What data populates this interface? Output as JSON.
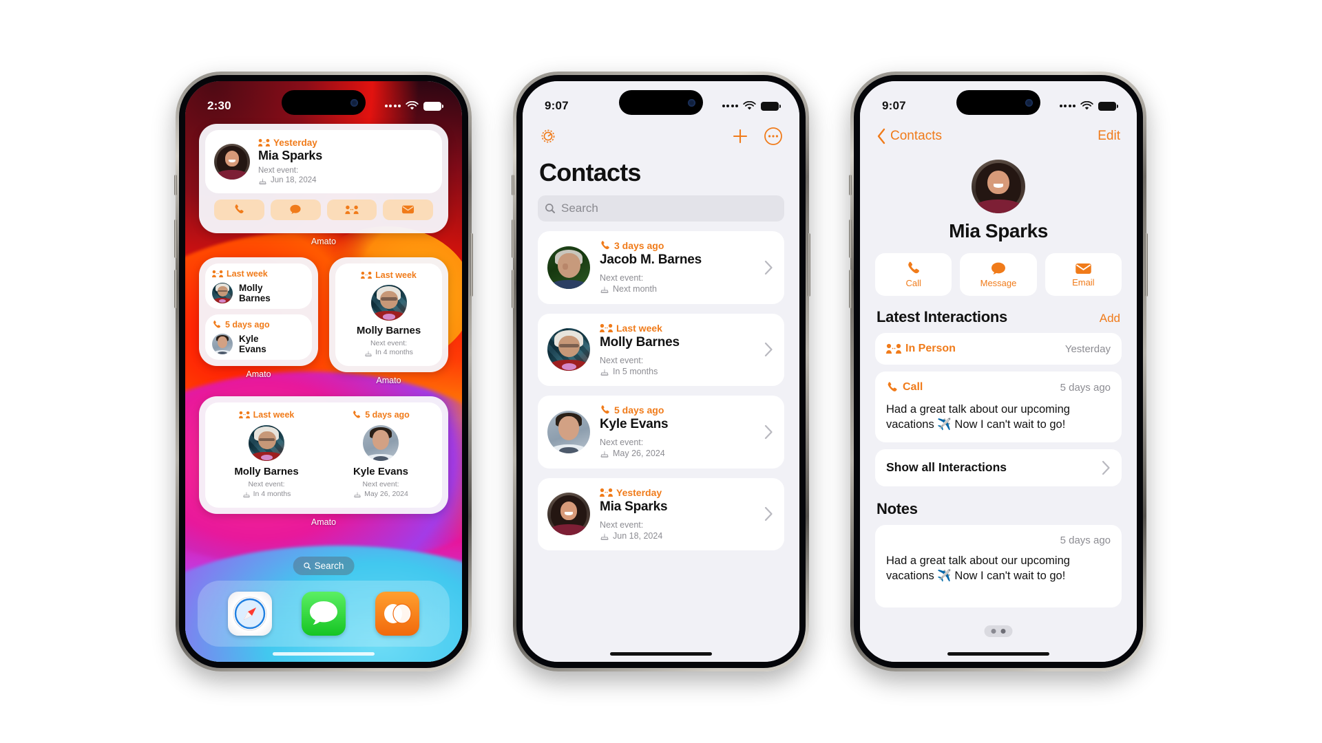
{
  "phone1": {
    "status": {
      "time": "2:30",
      "wifi": "wifi-icon",
      "battery": "battery-icon"
    },
    "widget_a": {
      "highlight": "Yesterday",
      "highlight_icon": "in-person-icon",
      "name": "Mia Sparks",
      "next_event_label": "Next event:",
      "next_event_value": "Jun 18, 2024",
      "event_icon": "birthday-cake-icon",
      "actions": [
        "phone-icon",
        "message-icon",
        "in-person-icon",
        "mail-icon"
      ],
      "label": "Amato"
    },
    "widget_b_left": {
      "items": [
        {
          "highlight": "Last week",
          "highlight_icon": "in-person-icon",
          "name": "Molly\nBarnes"
        },
        {
          "highlight": "5 days ago",
          "highlight_icon": "phone-icon",
          "name": "Kyle\nEvans"
        }
      ],
      "label": "Amato"
    },
    "widget_b_right": {
      "highlight": "Last week",
      "highlight_icon": "in-person-icon",
      "name": "Molly Barnes",
      "next_event_label": "Next event:",
      "next_event_value": "In 4 months",
      "event_icon": "birthday-cake-icon",
      "label": "Amato"
    },
    "widget_c": {
      "columns": [
        {
          "highlight": "Last week",
          "highlight_icon": "in-person-icon",
          "name": "Molly Barnes",
          "next_event_label": "Next event:",
          "next_event_value": "In 4 months",
          "event_icon": "birthday-cake-icon"
        },
        {
          "highlight": "5 days ago",
          "highlight_icon": "phone-icon",
          "name": "Kyle Evans",
          "next_event_label": "Next event:",
          "next_event_value": "May 26, 2024",
          "event_icon": "birthday-cake-icon"
        }
      ],
      "label": "Amato"
    },
    "search_pill": {
      "label": "Search",
      "icon": "search-icon"
    },
    "dock": [
      {
        "name": "safari-app-icon"
      },
      {
        "name": "messages-app-icon"
      },
      {
        "name": "amato-app-icon"
      }
    ]
  },
  "phone2": {
    "status": {
      "time": "9:07"
    },
    "nav": {
      "settings_icon": "gear-icon",
      "add_icon": "plus-icon",
      "more_icon": "ellipsis-circle-icon"
    },
    "title": "Contacts",
    "search": {
      "placeholder": "Search",
      "icon": "search-icon"
    },
    "contacts": [
      {
        "highlight": "3 days ago",
        "highlight_icon": "phone-icon",
        "name": "Jacob M. Barnes",
        "next_event_label": "Next event:",
        "next_event_value": "Next month",
        "event_icon": "birthday-cake-icon",
        "avatar": "jacob",
        "chevron": "chevron-right-icon"
      },
      {
        "highlight": "Last week",
        "highlight_icon": "in-person-icon",
        "name": "Molly Barnes",
        "next_event_label": "Next event:",
        "next_event_value": "In 5 months",
        "event_icon": "birthday-cake-icon",
        "avatar": "molly",
        "chevron": "chevron-right-icon"
      },
      {
        "highlight": "5 days ago",
        "highlight_icon": "phone-icon",
        "name": "Kyle Evans",
        "next_event_label": "Next event:",
        "next_event_value": "May 26, 2024",
        "event_icon": "birthday-cake-icon",
        "avatar": "kyle",
        "chevron": "chevron-right-icon"
      },
      {
        "highlight": "Yesterday",
        "highlight_icon": "in-person-icon",
        "name": "Mia Sparks",
        "next_event_label": "Next event:",
        "next_event_value": "Jun 18, 2024",
        "event_icon": "birthday-cake-icon",
        "avatar": "mia",
        "chevron": "chevron-right-icon"
      }
    ]
  },
  "phone3": {
    "status": {
      "time": "9:07"
    },
    "nav": {
      "back_label": "Contacts",
      "back_icon": "chevron-left-icon",
      "edit_label": "Edit"
    },
    "contact": {
      "name": "Mia Sparks",
      "avatar": "mia"
    },
    "actions": [
      {
        "label": "Call",
        "icon": "phone-icon"
      },
      {
        "label": "Message",
        "icon": "message-icon"
      },
      {
        "label": "Email",
        "icon": "mail-icon"
      }
    ],
    "interactions_section": {
      "title": "Latest Interactions",
      "action": "Add"
    },
    "interactions": [
      {
        "type": "In Person",
        "icon": "in-person-icon",
        "when": "Yesterday",
        "body": ""
      },
      {
        "type": "Call",
        "icon": "phone-icon",
        "when": "5 days ago",
        "body": "Had a great talk about our upcoming vacations ✈️ Now I can't wait to go!"
      }
    ],
    "show_all": {
      "label": "Show all Interactions",
      "chevron": "chevron-right-icon"
    },
    "notes_section": {
      "title": "Notes"
    },
    "note": {
      "when": "5 days ago",
      "body": "Had a great talk about our upcoming vacations ✈️ Now I can't wait to go!"
    }
  },
  "colors": {
    "accent": "#f07b1a",
    "app_bg": "#f1f1f6",
    "card": "#ffffff",
    "muted_text": "#8c8c92"
  }
}
